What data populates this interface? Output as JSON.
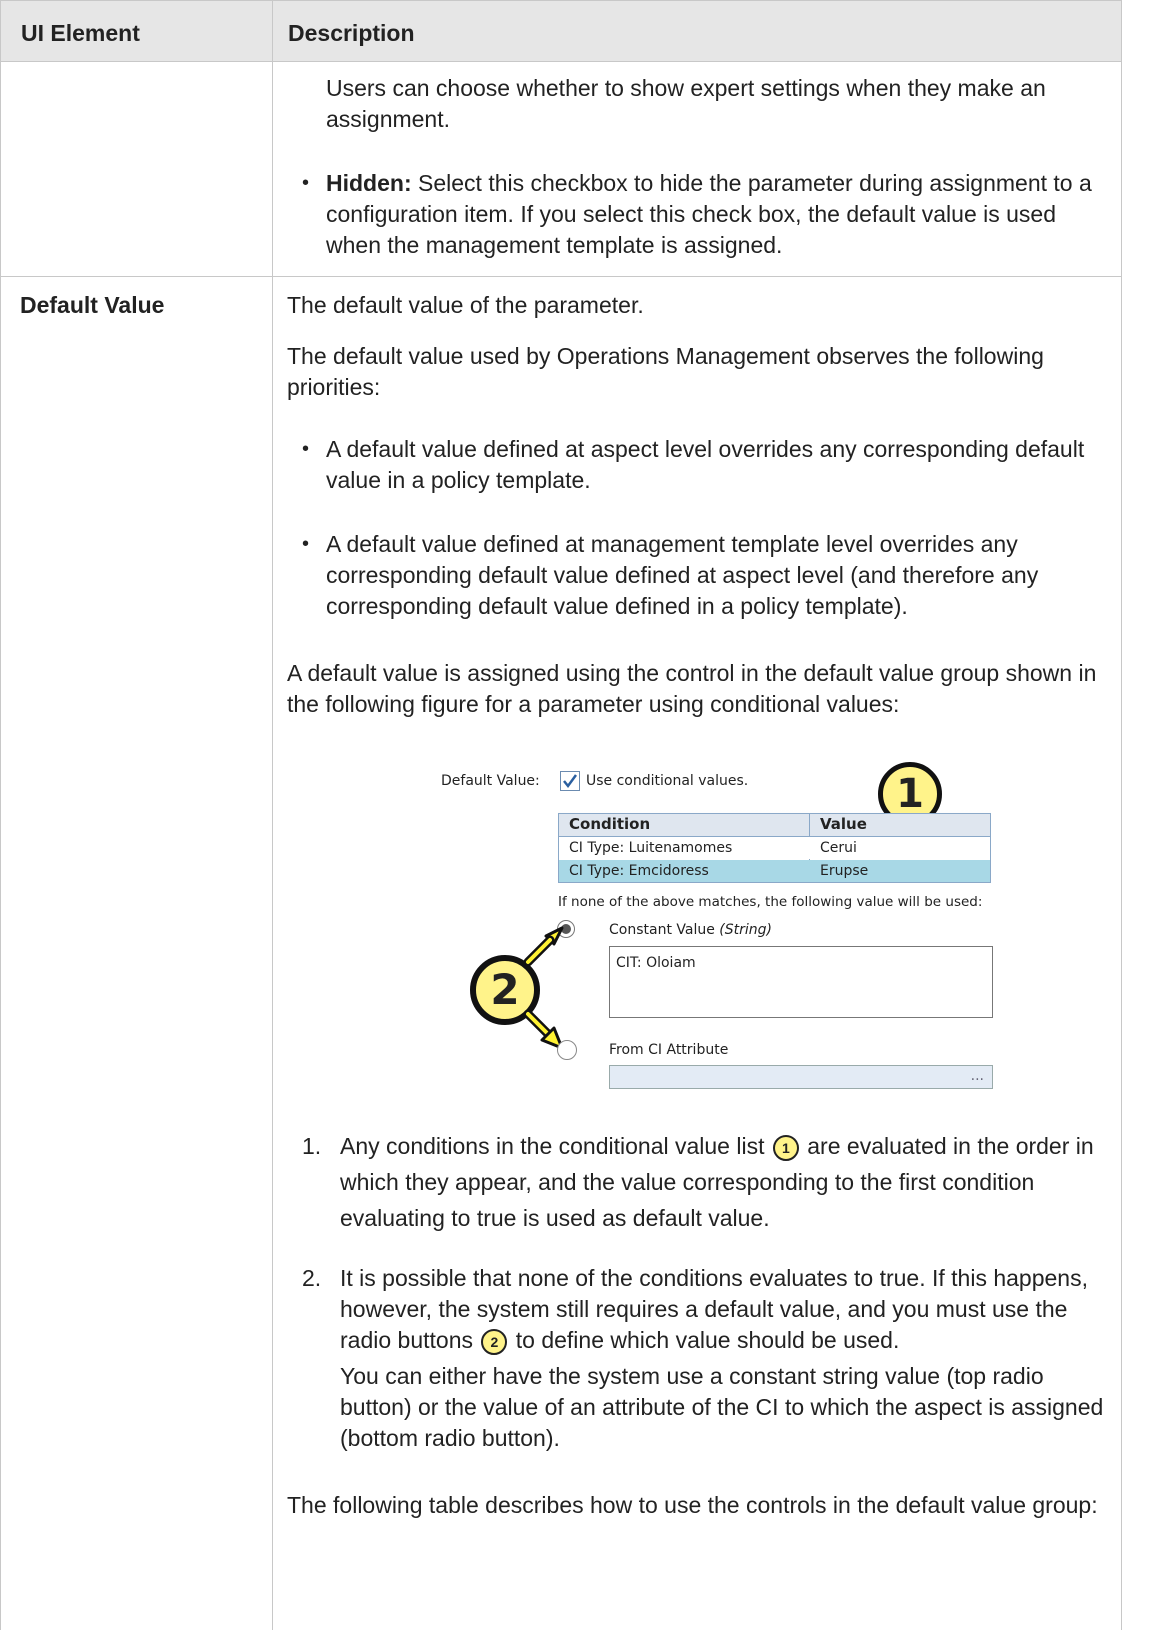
{
  "table": {
    "headers": [
      "UI Element",
      "Description"
    ]
  },
  "row1": {
    "p1": "Users can choose whether to show expert settings when they make an assignment.",
    "hidden_label": "Hidden:",
    "hidden_text": " Select this checkbox to hide the parameter during assignment to a configuration item. If you select this check box, the default value is used when the management template is assigned."
  },
  "row2": {
    "element": "Default Value",
    "p1": "The default value of the parameter.",
    "p2": "The default value used by Operations Management observes the following priorities:",
    "bullets": [
      "A default value defined at aspect level overrides any corresponding default value in a policy template.",
      "A default value defined at management template level overrides any corresponding default value defined at aspect level (and therefore any corresponding default value defined in a policy template)."
    ],
    "p3": "A default value is assigned using the control in the default value group shown in the following figure for a parameter using conditional values:",
    "list1_a": "Any conditions in the conditional value list",
    "list1_b": " are evaluated in the order in which they appear, and the value corresponding to the first condition evaluating to true is used as default value.",
    "list2_a": "It is possible that none of the conditions evaluates to true. If this happens, however, the system still requires a default value, and you must use the radio buttons",
    "list2_b": " to define which value should be used.",
    "list2_c": "You can either have the system use a constant string value (top radio button) or the value of an attribute of the CI to which the aspect is assigned (bottom radio button).",
    "p4": "The following table describes how to use the controls in the default value group:"
  },
  "figure": {
    "default_value_label": "Default Value:",
    "use_conditional": "Use conditional values.",
    "columns": [
      "Condition",
      "Value"
    ],
    "rows": [
      [
        "CI Type: Luitenamomes",
        "Cerui"
      ],
      [
        "CI Type: Emcidoress",
        "Erupse"
      ]
    ],
    "fallback_text": "If none of the above matches, the following value will be used:",
    "constant_label": "Constant Value",
    "constant_type": "(String)",
    "constant_value": "CIT: Oloiam",
    "attribute_label": "From CI Attribute",
    "ellipsis": "...",
    "callouts": [
      "1",
      "2"
    ],
    "highlight_color": "#a8d8e6",
    "callout_fill": "#fff38a"
  }
}
